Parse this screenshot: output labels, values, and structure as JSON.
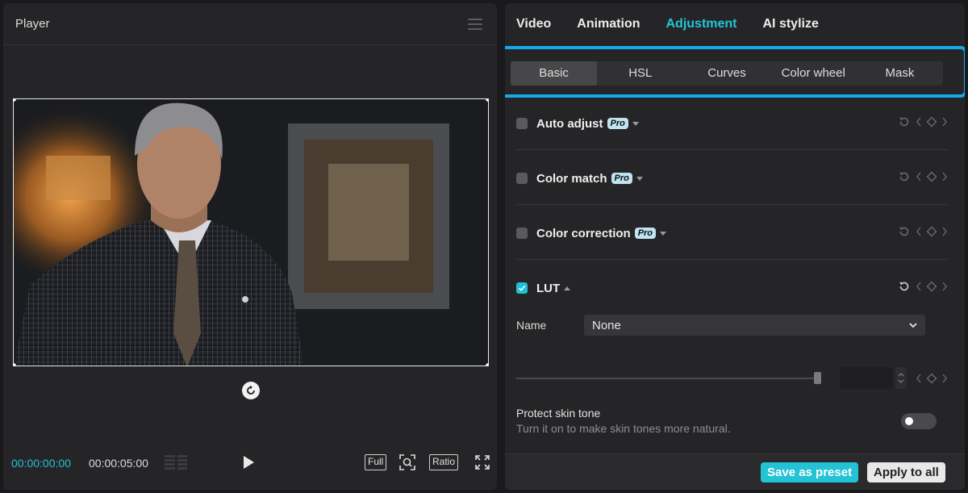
{
  "player": {
    "title": "Player",
    "time_current": "00:00:00:00",
    "time_total": "00:00:05:00",
    "buttons": {
      "full": "Full",
      "ratio": "Ratio"
    }
  },
  "right_panel": {
    "main_tabs": [
      {
        "label": "Video",
        "active": false
      },
      {
        "label": "Animation",
        "active": false
      },
      {
        "label": "Adjustment",
        "active": true
      },
      {
        "label": "AI stylize",
        "active": false
      }
    ],
    "sub_tabs": [
      {
        "label": "Basic",
        "active": true
      },
      {
        "label": "HSL",
        "active": false
      },
      {
        "label": "Curves",
        "active": false
      },
      {
        "label": "Color wheel",
        "active": false
      },
      {
        "label": "Mask",
        "active": false
      }
    ],
    "sections": {
      "auto_adjust": {
        "label": "Auto adjust",
        "badge": "Pro",
        "checked": false
      },
      "color_match": {
        "label": "Color match",
        "badge": "Pro",
        "checked": false
      },
      "color_correction": {
        "label": "Color correction",
        "badge": "Pro",
        "checked": false
      },
      "lut": {
        "label": "LUT",
        "checked": true,
        "expanded": true
      }
    },
    "lut": {
      "name_label": "Name",
      "name_value": "None",
      "intensity_fraction": 1.0
    },
    "protect_skin_tone": {
      "title": "Protect skin tone",
      "description": "Turn it on to make skin tones more natural.",
      "enabled": false
    },
    "footer": {
      "save_preset": "Save as preset",
      "apply_all": "Apply to all"
    }
  },
  "colors": {
    "accent": "#22c6d8",
    "highlight_border": "#16a8e8",
    "panel_bg": "#252527"
  }
}
